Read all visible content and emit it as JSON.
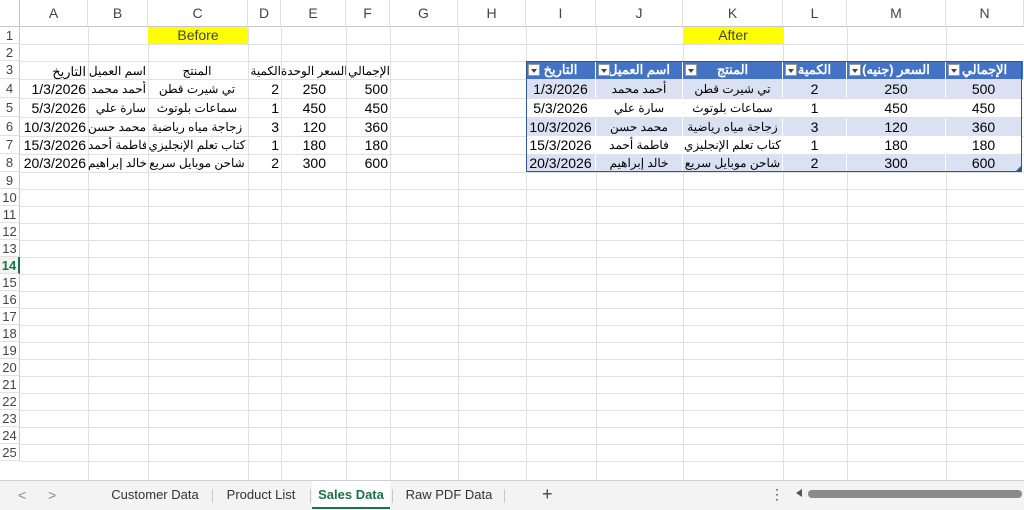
{
  "columns": [
    "A",
    "B",
    "C",
    "D",
    "E",
    "F",
    "G",
    "H",
    "I",
    "J",
    "K",
    "L",
    "M",
    "N"
  ],
  "rows": [
    "1",
    "2",
    "3",
    "4",
    "5",
    "6",
    "7",
    "8",
    "9",
    "10",
    "11",
    "12",
    "13",
    "14",
    "15",
    "16",
    "17",
    "18",
    "19",
    "20",
    "21",
    "22",
    "23",
    "24",
    "25"
  ],
  "labels": {
    "before": "Before",
    "after": "After"
  },
  "before_table": {
    "headers": [
      "التاريخ",
      "اسم العميل",
      "المنتج",
      "الكمية",
      "السعر الوحدة",
      "الإجمالي"
    ],
    "rows": [
      [
        "1/3/2026",
        "أحمد محمد",
        "تي شيرت قطن",
        "2",
        "250",
        "500"
      ],
      [
        "5/3/2026",
        "سارة علي",
        "سماعات بلوتوث",
        "1",
        "450",
        "450"
      ],
      [
        "10/3/2026",
        "محمد حسن",
        "زجاجة مياه رياضية",
        "3",
        "120",
        "360"
      ],
      [
        "15/3/2026",
        "فاطمة أحمد",
        "كتاب تعلم الإنجليزي",
        "1",
        "180",
        "180"
      ],
      [
        "20/3/2026",
        "خالد إبراهيم",
        "شاحن موبايل سريع",
        "2",
        "300",
        "600"
      ]
    ]
  },
  "after_table": {
    "headers": [
      "التاريخ",
      "اسم العميل",
      "المنتج",
      "الكمية",
      "السعر (جنيه)",
      "الإجمالي"
    ],
    "rows": [
      [
        "1/3/2026",
        "أحمد محمد",
        "تي شيرت قطن",
        "2",
        "250",
        "500"
      ],
      [
        "5/3/2026",
        "سارة علي",
        "سماعات بلوتوث",
        "1",
        "450",
        "450"
      ],
      [
        "10/3/2026",
        "محمد حسن",
        "زجاجة مياه رياضية",
        "3",
        "120",
        "360"
      ],
      [
        "15/3/2026",
        "فاطمة أحمد",
        "كتاب تعلم الإنجليزي",
        "1",
        "180",
        "180"
      ],
      [
        "20/3/2026",
        "خالد إبراهيم",
        "شاحن موبايل سريع",
        "2",
        "300",
        "600"
      ]
    ]
  },
  "sheet_tabs": [
    {
      "label": "Customer Data",
      "active": false
    },
    {
      "label": "Product List",
      "active": false
    },
    {
      "label": "Sales Data",
      "active": true
    },
    {
      "label": "Raw PDF Data",
      "active": false
    }
  ],
  "active_row": "14",
  "colors": {
    "table_header": "#4472c4",
    "band": "#d9e1f2",
    "highlight": "#ffff00",
    "accent": "#1e7145"
  }
}
